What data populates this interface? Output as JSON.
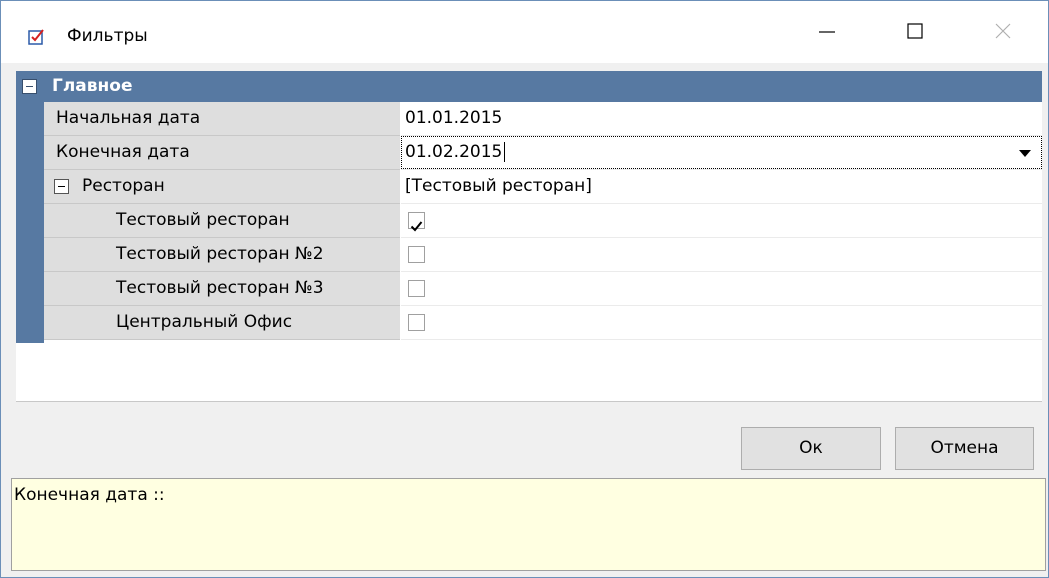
{
  "window": {
    "title": "Фильтры",
    "accent_color": "#5779a2",
    "icons": {
      "app": "checklist-icon",
      "minimize": "minimize-icon",
      "maximize": "maximize-icon",
      "close": "close-icon"
    }
  },
  "grid": {
    "category": {
      "label": "Главное",
      "expanded": true
    },
    "rows": [
      {
        "name": "Начальная дата",
        "value": "01.01.2015"
      },
      {
        "name": "Конечная дата",
        "value": "01.02.2015"
      },
      {
        "name": "Ресторан",
        "value": "[Тестовый ресторан]",
        "expanded": true
      },
      {
        "name": "Тестовый ресторан",
        "checked": true
      },
      {
        "name": "Тестовый ресторан №2",
        "checked": false
      },
      {
        "name": "Тестовый ресторан №3",
        "checked": false
      },
      {
        "name": "Центральный Офис",
        "checked": false
      }
    ]
  },
  "buttons": {
    "ok": "Ок",
    "cancel": "Отмена"
  },
  "description": {
    "text": "Конечная дата ::"
  }
}
